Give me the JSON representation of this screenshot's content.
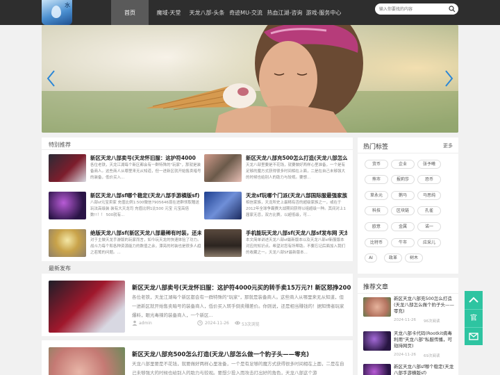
{
  "logo": {
    "text": "水"
  },
  "nav": {
    "items": [
      {
        "label": "首页"
      },
      {
        "label": "魔域-天堂"
      },
      {
        "label": "天龙八部-头条"
      },
      {
        "label": "奇迹MU-交流"
      },
      {
        "label": "热血江湖-咨询"
      },
      {
        "label": "游戏-服务中心"
      }
    ]
  },
  "search": {
    "placeholder": "输入你要找的内容"
  },
  "featured": {
    "title": "特别推荐",
    "items": [
      {
        "title": "新区天龙八部卖号(天龙怀旧服：这护符4000",
        "excerpt": "各位老铁，天龙江湖每个新区都会有一群特殊的\"玩家\"，那就是装备商人。这些商人从哪里来无从知道，但一进新区就开始售卖暗号的装备，低价买入..."
      },
      {
        "title": "新区天龙八部充500怎么打造(天龙八部怎么做",
        "excerpt": "天龙八部里要是不花钱，就要做好两样心里准备，一个是有足够的魔方式获得很多时间相在上面，二是在自己未够强大的时候也给别人的助力与较视。要想..."
      },
      {
        "title": "新区天龙八部sf哪个稳定(天龙八部手游横版sf)",
        "excerpt": "八部sf元宝卖家 充值比例1:500微信7905646现在进群领取赠送 玩法高级装 装有大天龙司 充值比例1比500 元宝 元宝高倍数!!！！ 500就有..."
      },
      {
        "title": "天龙sf玩哪个门派(天龙八部国际服最强家族盘",
        "excerpt": "相信家族，天龙所史上最精有否的超级家族之一，或在于2012年全球争霸赛大战期间获得以组超级一种。其间对上1届家无忌，双方比赛，以超低级，可..."
      },
      {
        "title": "绝版天龙八部sf(新区天龙八部最稀有时装，还未",
        "excerpt": "对于主做天龙手游版的玩家而言，如今玩天龙的快速体验了功力。战斗力每个和各种资源能力的数值之余，漂亮的时装也是很多人趋之若鹜的问题。..."
      },
      {
        "title": "手机能玩天龙八部sf(天龙八部sf发布网 天龙八",
        "excerpt": "本文简单讲述天龙八部sf最新版本以及天龙八部sf新服版本对应的知识点。希望对您有所帮助。不要忘记后面加入我们的收藏之一。天龙八部SF最新版本..."
      }
    ]
  },
  "latest": {
    "title": "最新发布",
    "posts": [
      {
        "title": "新区天龙八部卖号(天龙怀旧服：这护符4000元买的转手卖15万元?! 新区怒挣200",
        "excerpt": "各位老铁，天龙江湖每个新区都会有一群特殊的\"玩家\"，那就是装备商人。这些商人从哪里来无从知道，但一进新区就开始售卖暗号的装备商人，低价买入转手倒卖赚差价。你则说，还是相当赚钱的！据知情者玩家爆料，眼光毒辣的装备商人，一个新区...",
        "author": "admin",
        "date": "2024-11-26",
        "views": "53次浏览"
      },
      {
        "title": "新区天龙八部充500怎么打造(天龙八部怎么做一个豹子头——零充)",
        "excerpt": "天龙八部里要是不花钱，就要做好两样心里准备，一个是有足够的魔方式获得很多时间相在上面，二是在自己未够强大的时候也给别人的助力与较视。要想少投入而攻击打出好的角色，天龙八部这个游",
        "author": "",
        "date": "",
        "views": ""
      }
    ]
  },
  "hot_tags": {
    "title": "热门标签",
    "more": "更多",
    "tags": [
      "货币",
      "企业",
      "张予曦",
      "熊市",
      "报莉莎",
      "恐币",
      "草永元",
      "鹅马",
      "马思纯",
      "科技",
      "区块链",
      "孔雀",
      "欧意",
      "金属",
      "诺一",
      "比特币",
      "牛市",
      "应采儿",
      "AI",
      "政革",
      "树木"
    ]
  },
  "recommended": {
    "title": "推荐文章",
    "items": [
      {
        "title": "新区天龙八部充500怎么打造(天龙八部怎么做个豹子头——零充)",
        "date": "2024-11-26",
        "views": "96次阅读"
      },
      {
        "title": "天龙八部卡代码(Rootkit病毒利用\"天龙八部\"私服传播，可劫持网页)",
        "date": "2024-11-26",
        "views": "69次阅读"
      },
      {
        "title": "新区天龙八部sf哪个稳定(天龙八部手游横版sf)",
        "date": "",
        "views": ""
      }
    ]
  },
  "float": {
    "up": "^",
    "gov": "官",
    "mail": "✉"
  },
  "colors": {
    "accent": "#2ec4a1",
    "topbar": "#2e2e2e"
  }
}
